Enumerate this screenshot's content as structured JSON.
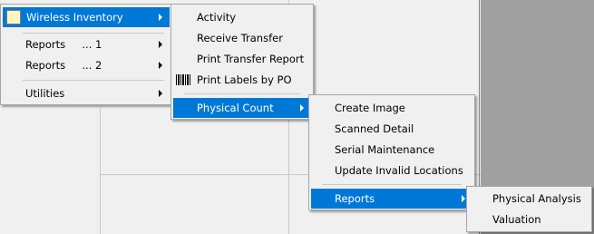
{
  "main_menu": {
    "items": [
      {
        "label": "Wireless Inventory",
        "highlighted": true,
        "has_submenu": true,
        "icon": "inventory-icon"
      },
      {
        "label": "Reports     ... 1",
        "has_submenu": true
      },
      {
        "label": "Reports     ... 2",
        "has_submenu": true
      },
      {
        "label": "Utilities",
        "has_submenu": true
      }
    ]
  },
  "wireless_inventory_menu": {
    "items": [
      {
        "label": "Activity"
      },
      {
        "label": "Receive Transfer"
      },
      {
        "label": "Print Transfer Report"
      },
      {
        "label": "Print Labels by PO",
        "icon": "barcode-icon"
      },
      {
        "label": "Physical Count",
        "highlighted": true,
        "has_submenu": true
      }
    ]
  },
  "physical_count_menu": {
    "items": [
      {
        "label": "Create Image"
      },
      {
        "label": "Scanned Detail"
      },
      {
        "label": "Serial Maintenance"
      },
      {
        "label": "Update Invalid Locations"
      },
      {
        "label": "Reports",
        "highlighted": true,
        "has_submenu": true
      }
    ]
  },
  "reports_menu": {
    "items": [
      {
        "label": "Physical Analysis"
      },
      {
        "label": "Valuation"
      }
    ]
  },
  "colors": {
    "highlight": "#0078d7",
    "menu_bg": "#f0f0f0",
    "desktop_bg": "#a0a0a0"
  }
}
